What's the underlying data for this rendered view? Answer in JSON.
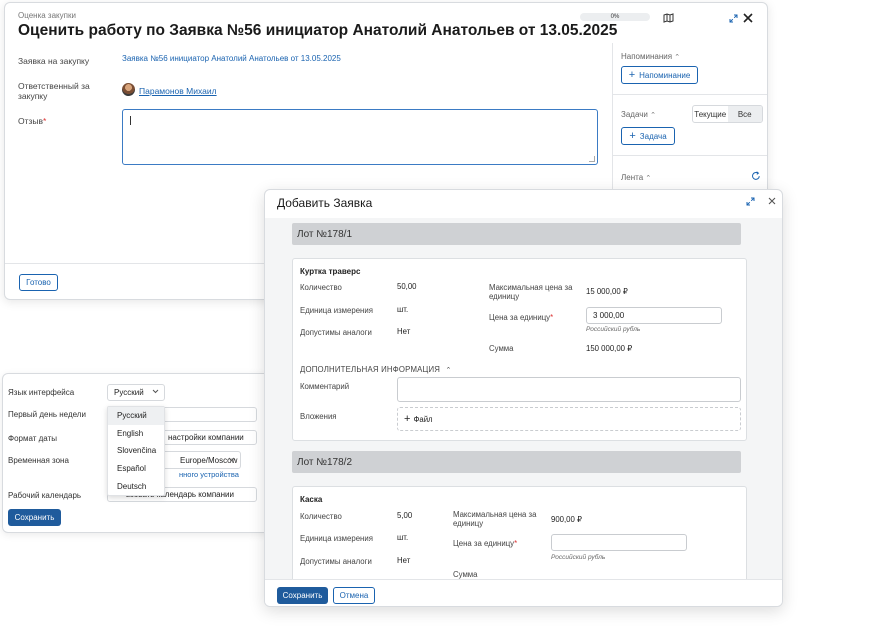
{
  "main": {
    "breadcrumb": "Оценка закупки",
    "title": "Оценить работу по Заявка №56 инициатор Анатолий Анатольев от 13.05.2025",
    "progress_text": "0%",
    "progress_value": 0,
    "fields": {
      "request_label": "Заявка на закупку",
      "request_value": "Заявка №56 инициатор Анатолий Анатольев от 13.05.2025",
      "responsible_label_1": "Ответственный за",
      "responsible_label_2": "закупку",
      "responsible_value": "Парамонов Михаил",
      "review_label": "Отзыв",
      "review_required_mark": "*",
      "review_value": ""
    },
    "done_button": "Готово"
  },
  "sidebar": {
    "reminders_title": "Напоминания",
    "reminder_button": "Напоминание",
    "tasks_title": "Задачи",
    "tasks_filter": [
      "Текущие",
      "Все"
    ],
    "tasks_filter_active": "Все",
    "task_button": "Задача",
    "feed_title": "Лента"
  },
  "settings": {
    "language_label": "Язык интерфейса",
    "language_value": "Русский",
    "language_options": [
      "Русский",
      "English",
      "Slovenčina",
      "Español",
      "Deutsch"
    ],
    "first_day_label": "Первый день недели",
    "date_format_label": "Формат даты",
    "date_format_value": "настройки компании",
    "timezone_label": "Временная зона",
    "timezone_value": "Europe/Moscow",
    "timezone_link": "нного устройства",
    "calendar_label": "Рабочий календарь",
    "calendar_value": "ьзовать календарь компании",
    "save_button": "Сохранить"
  },
  "modal": {
    "title": "Добавить Заявка",
    "lots": [
      {
        "header": "Лот №178/1",
        "item_name": "Куртка траверс",
        "quantity_label": "Количество",
        "quantity_value": "50,00",
        "unit_label": "Единица измерения",
        "unit_value": "шт.",
        "analogs_label": "Допустимы аналоги",
        "analogs_value": "Нет",
        "max_price_label_1": "Максимальная цена за",
        "max_price_label_2": "единицу",
        "max_price_value": "15 000,00 ₽",
        "unit_price_label": "Цена за единицу",
        "unit_price_required": "*",
        "unit_price_value": "3 000,00",
        "currency_note": "Российский рубль",
        "sum_label": "Сумма",
        "sum_value": "150 000,00 ₽"
      },
      {
        "header": "Лот №178/2",
        "item_name": "Каска",
        "quantity_label": "Количество",
        "quantity_value": "5,00",
        "unit_label": "Единица измерения",
        "unit_value": "шт.",
        "analogs_label": "Допустимы аналоги",
        "analogs_value": "Нет",
        "max_price_label_1": "Максимальная цена за",
        "max_price_label_2": "единицу",
        "max_price_value": "900,00 ₽",
        "unit_price_label": "Цена за единицу",
        "unit_price_required": "*",
        "unit_price_value": "",
        "currency_note": "Российский рубль",
        "sum_label": "Сумма"
      }
    ],
    "extra_info_title": "ДОПОЛНИТЕЛЬНАЯ ИНФОРМАЦИЯ",
    "comment_label": "Комментарий",
    "attachments_label": "Вложения",
    "file_button": "Файл",
    "save_button": "Сохранить",
    "cancel_button": "Отмена"
  },
  "icons": [
    "map-icon",
    "expand-icon",
    "close-icon",
    "plus-icon",
    "chevron-up-icon",
    "refresh-icon",
    "chevron-down-icon"
  ],
  "colors": {
    "accent": "#1f5b9c",
    "link": "#1a63b0",
    "required": "#d33333",
    "lot_bar": "#cfd1d4"
  }
}
